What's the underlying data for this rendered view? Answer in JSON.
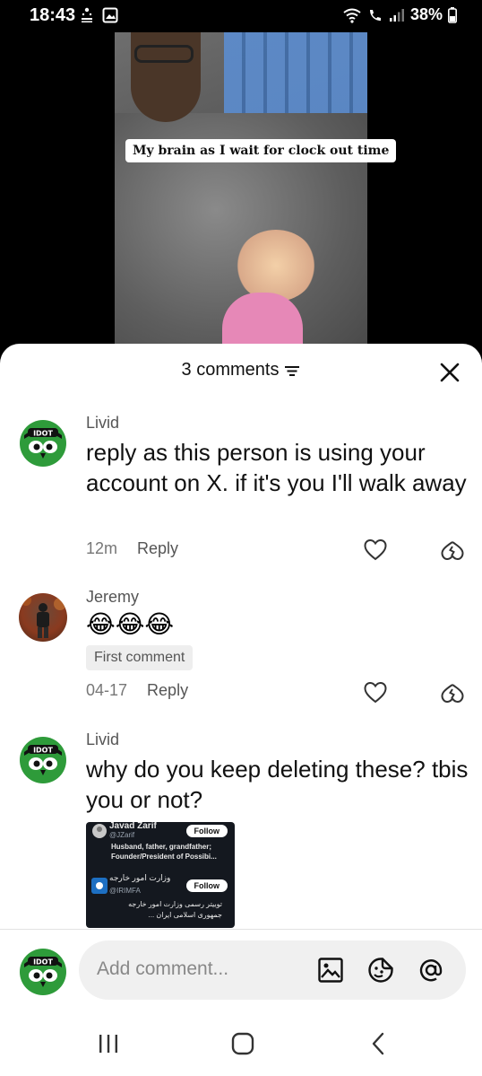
{
  "status_bar": {
    "time": "18:43",
    "battery": "38%",
    "icons": [
      "notification-icon",
      "image-icon",
      "wifi-icon",
      "call-icon",
      "signal-icon",
      "battery-icon"
    ]
  },
  "video": {
    "caption": "My brain as I wait for clock out time"
  },
  "sheet": {
    "title": "3 comments",
    "sort_icon": "sort-icon",
    "close_icon": "close-icon"
  },
  "comments": [
    {
      "user": "Livid",
      "avatar_label": "IDOT",
      "text": "reply as this person is using your account on X. if it's you I'll walk away",
      "date": "12m",
      "reply_label": "Reply"
    },
    {
      "user": "Jeremy",
      "text": "😂😂😂",
      "badge": "First comment",
      "date": "04-17",
      "reply_label": "Reply"
    },
    {
      "user": "Livid",
      "avatar_label": "IDOT",
      "text": "why do you keep deleting these? tbis you or not?",
      "embed": {
        "name1": "Javad Zarif",
        "handle1": "@JZarif",
        "follow1": "Follow",
        "bio1": "Husband, father, grandfather; Founder/President of Possibi...",
        "name2": "وزارت امور خارجه",
        "handle2": "@IRIMFA",
        "follow2": "Follow",
        "bio2": "توییتر رسمی وزارت امور خارجه جمهوری اسلامی ایران ..."
      }
    }
  ],
  "add_comment": {
    "avatar_label": "IDOT",
    "placeholder": "Add comment..."
  },
  "colors": {
    "sheet_bg": "#ffffff",
    "text": "#111111",
    "muted": "#777777",
    "input_bg": "#f0f0f0",
    "idot_green": "#2e9b3a"
  }
}
